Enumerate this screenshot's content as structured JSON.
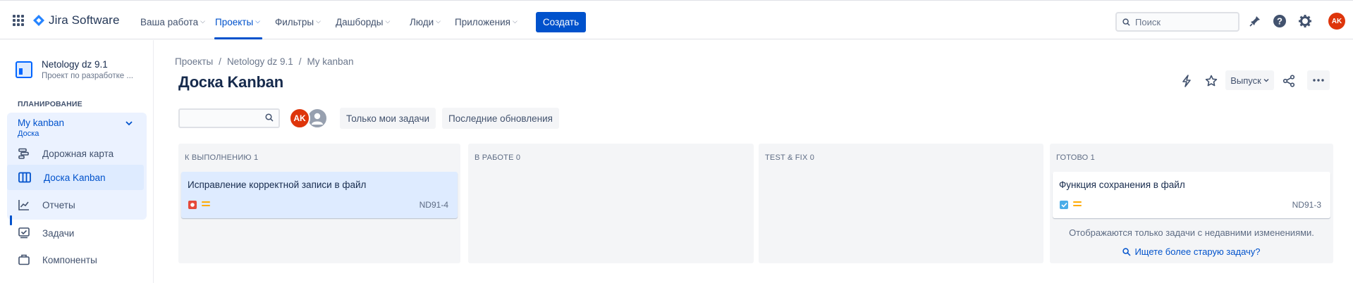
{
  "app": {
    "name": "Jira Software"
  },
  "nav": {
    "items": [
      {
        "label": "Ваша работа"
      },
      {
        "label": "Проекты"
      },
      {
        "label": "Фильтры"
      },
      {
        "label": "Дашборды"
      },
      {
        "label": "Люди"
      },
      {
        "label": "Приложения"
      }
    ],
    "active": "Проекты",
    "create_label": "Создать",
    "search_placeholder": "Поиск",
    "user_initials": "AK",
    "accent": "#0052cc"
  },
  "sidebar": {
    "project_name": "Netology dz 9.1",
    "project_sub": "Проект по разработке ...",
    "section_title": "ПЛАНИРОВАНИЕ",
    "board_title": "My kanban",
    "board_sub": "Доска",
    "items": [
      {
        "label": "Дорожная карта",
        "icon": "roadmap-icon"
      },
      {
        "label": "Доска Kanban",
        "icon": "board-icon",
        "selected": true
      },
      {
        "label": "Отчеты",
        "icon": "reports-icon"
      },
      {
        "label": "Задачи",
        "icon": "issues-icon"
      },
      {
        "label": "Компоненты",
        "icon": "components-icon"
      }
    ]
  },
  "breadcrumb": [
    "Проекты",
    "Netology dz 9.1",
    "My kanban"
  ],
  "page": {
    "title": "Доска Kanban",
    "release_label": "Выпуск",
    "avatar_initials": "AK",
    "filters": [
      "Только мои задачи",
      "Последние обновления"
    ]
  },
  "columns": [
    {
      "title": "К ВЫПОЛНЕНИЮ 1",
      "cards": [
        {
          "title": "Исправление корректной записи в файл",
          "key": "ND91-4",
          "type": "bug",
          "type_color": "#e5493a",
          "priority": "medium"
        }
      ]
    },
    {
      "title": "В РАБОТЕ 0",
      "cards": []
    },
    {
      "title": "TEST & FIX 0",
      "cards": []
    },
    {
      "title": "ГОТОВО 1",
      "cards": [
        {
          "title": "Функция сохранения в файл",
          "key": "ND91-3",
          "type": "task",
          "type_color": "#4bade8",
          "priority": "medium"
        }
      ],
      "note": "Отображаются только задачи с недавними изменениями.",
      "link": "Ищете более старую задачу?"
    }
  ]
}
